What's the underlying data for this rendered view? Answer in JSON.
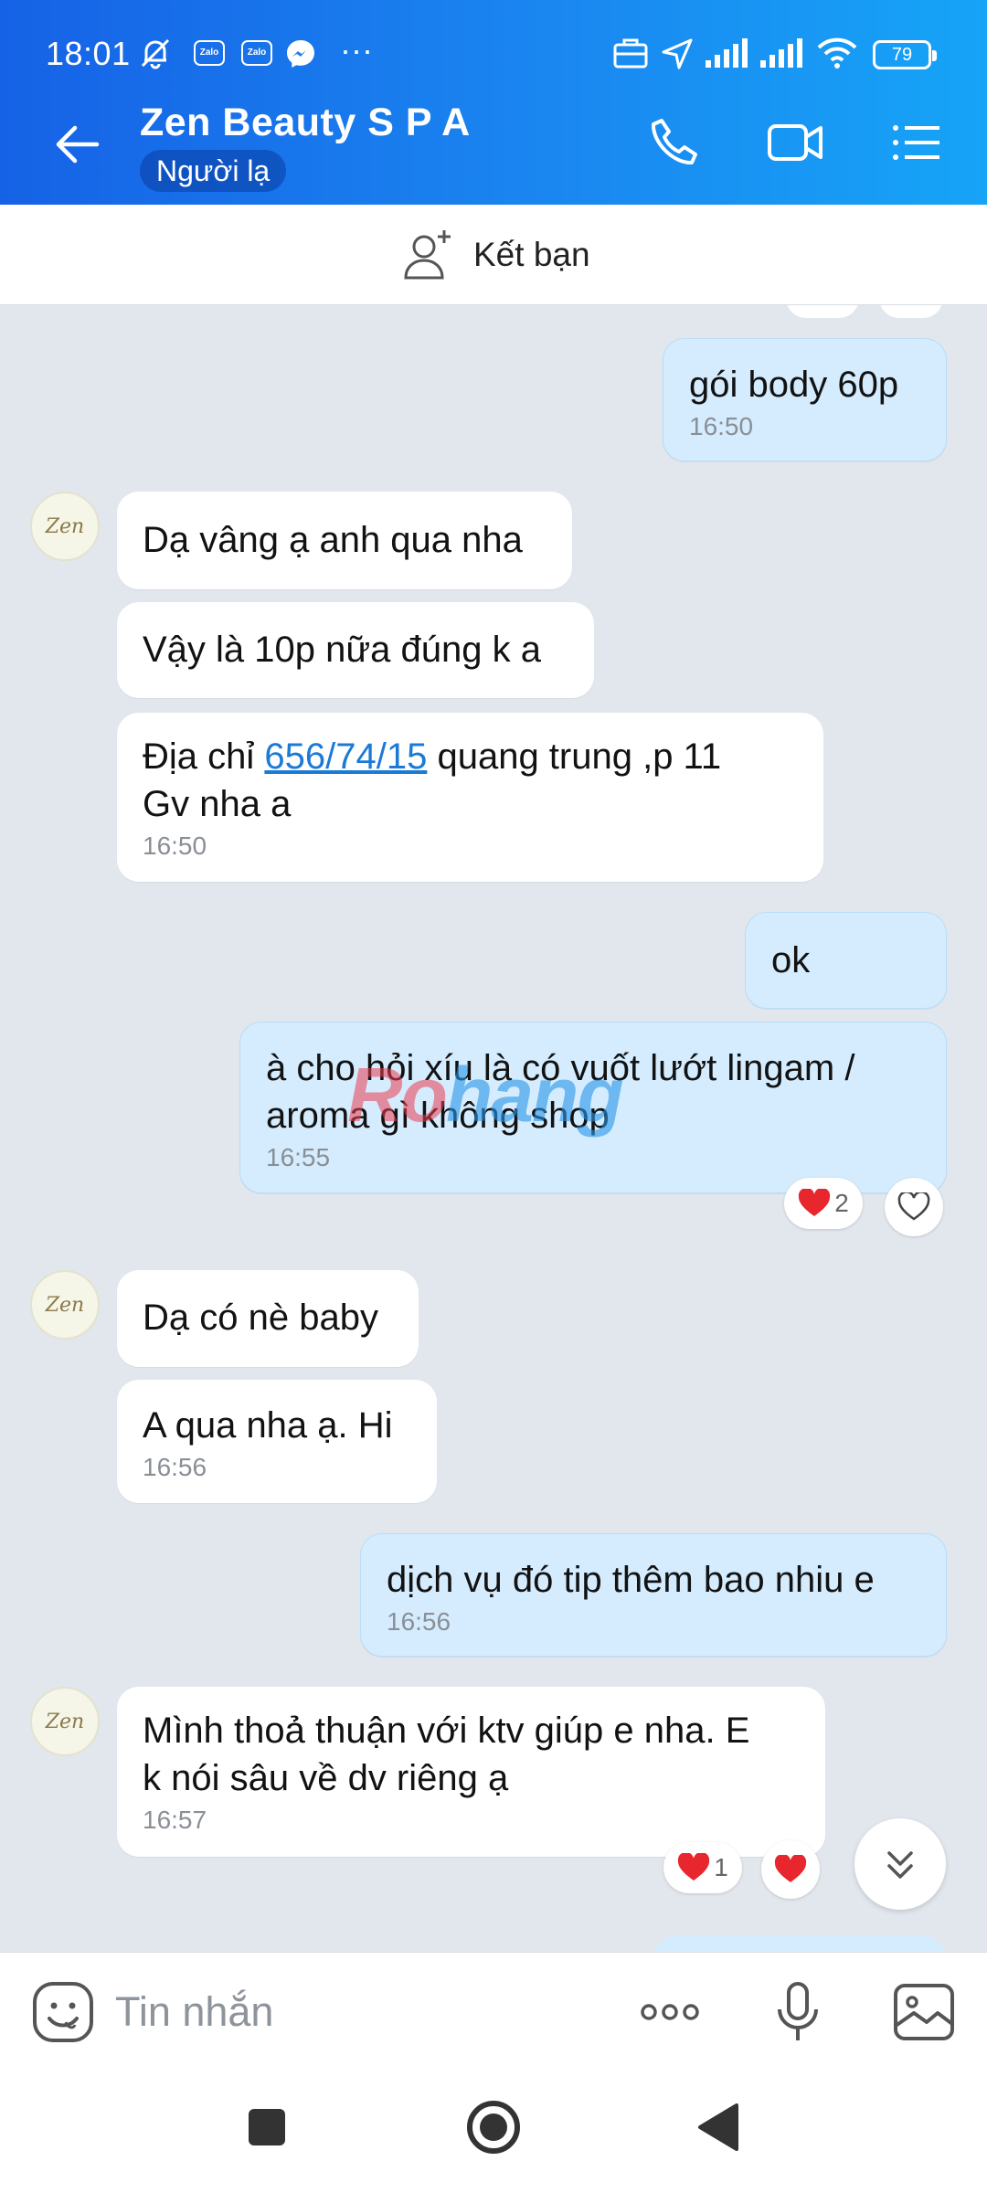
{
  "status_bar": {
    "time": "18:01",
    "battery": "79",
    "app_badge_1": "Zalo",
    "app_badge_2": "Zalo",
    "more": "···"
  },
  "header": {
    "contact_name": "Zen Beauty S P A",
    "badge": "Người lạ"
  },
  "add_friend": {
    "label": "Kết bạn"
  },
  "messages": [
    {
      "dir": "out",
      "text": "gói body 60p",
      "time": "16:50"
    },
    {
      "dir": "in",
      "text": "Dạ vâng ạ anh qua nha"
    },
    {
      "dir": "in",
      "text": "Vậy là 10p nữa đúng k a"
    },
    {
      "dir": "in",
      "text_pre": "Địa chỉ ",
      "link": "656/74/15",
      "text_post": " quang trung ,p 11",
      "text_line2": "Gv nha a",
      "time": "16:50"
    },
    {
      "dir": "out",
      "text": "ok"
    },
    {
      "dir": "out",
      "text_line1": "à cho hỏi xíu là có vuốt lướt lingam /",
      "text_line2": "aroma gì không shop",
      "time": "16:55",
      "reaction_count": "2"
    },
    {
      "dir": "in",
      "text": "Dạ có nè baby"
    },
    {
      "dir": "in",
      "text": "A qua nha ạ. Hi",
      "time": "16:56"
    },
    {
      "dir": "out",
      "text": "dịch vụ đó tip thêm bao nhiu e",
      "time": "16:56"
    },
    {
      "dir": "in",
      "text_line1": "Mình thoả thuận với ktv giúp e nha. E",
      "text_line2": "k nói sâu về dv riêng ạ",
      "time": "16:57",
      "reaction_count": "1"
    }
  ],
  "avatar_text": "Zen",
  "watermark": {
    "part1": "Ro",
    "part2": "hang"
  },
  "input": {
    "placeholder": "Tin nhắn"
  },
  "colors": {
    "header_start": "#1662e6",
    "header_end": "#16a4f7",
    "outgoing_bubble": "#d4ecfe",
    "incoming_bubble": "#ffffff",
    "chat_background": "#e2e7ee",
    "link": "#1b7ad6",
    "reaction_heart": "#e8262e"
  }
}
